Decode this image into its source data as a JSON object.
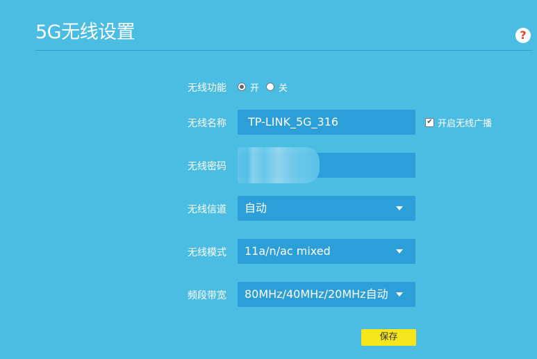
{
  "header": {
    "title": "5G无线设置",
    "help_glyph": "?"
  },
  "wireless_function": {
    "label": "无线功能",
    "options": [
      "开",
      "关"
    ],
    "selected": "开"
  },
  "ssid": {
    "label": "无线名称",
    "value": "TP-LINK_5G_316",
    "broadcast_label": "开启无线广播",
    "broadcast_checked": true,
    "check_glyph": "✔"
  },
  "password": {
    "label": "无线密码",
    "value_redacted": true
  },
  "channel": {
    "label": "无线信道",
    "value": "自动"
  },
  "mode": {
    "label": "无线模式",
    "value": "11a/n/ac mixed"
  },
  "bandwidth": {
    "label": "频段带宽",
    "value": "80MHz/40MHz/20MHz自动"
  },
  "actions": {
    "save_label": "保存"
  },
  "colors": {
    "background": "#4bbde2",
    "field": "#2c9fd8",
    "save_button": "#f7e61c",
    "help_mark": "#e8432c"
  }
}
